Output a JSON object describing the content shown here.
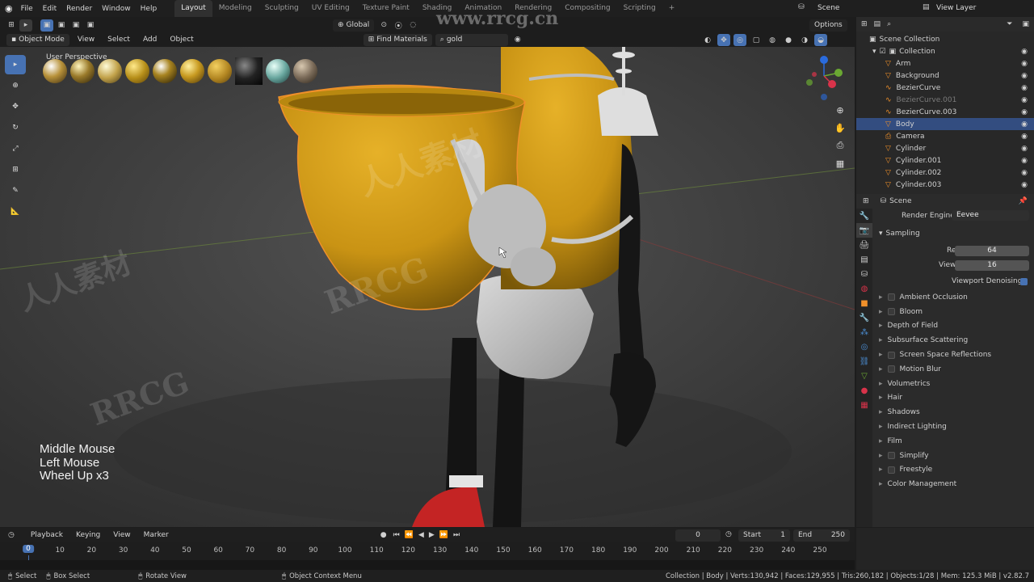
{
  "topbar": {
    "menus": [
      "File",
      "Edit",
      "Render",
      "Window",
      "Help"
    ],
    "tabs": [
      "Layout",
      "Modeling",
      "Sculpting",
      "UV Editing",
      "Texture Paint",
      "Shading",
      "Animation",
      "Rendering",
      "Compositing",
      "Scripting"
    ],
    "scene": "Scene",
    "view_layer": "View Layer"
  },
  "viewport_header": {
    "transform": "Global",
    "options": "Options",
    "mode": "Object Mode",
    "menus": [
      "View",
      "Select",
      "Add",
      "Object"
    ],
    "find_materials": "Find Materials",
    "search_value": "gold"
  },
  "viewport": {
    "perspective_label": "User Perspective",
    "overlay_lines": [
      "Middle Mouse",
      "Left Mouse",
      "Wheel Up x3"
    ],
    "watermark": "www.rrcg.cn",
    "watermark_brand": "RRCG",
    "watermark_cn": "人人素材"
  },
  "outliner": {
    "root": "Scene Collection",
    "collection": "Collection",
    "items": [
      {
        "name": "Arm",
        "selected": false,
        "dim": false
      },
      {
        "name": "Background",
        "selected": false,
        "dim": false
      },
      {
        "name": "BezierCurve",
        "selected": false,
        "dim": false
      },
      {
        "name": "BezierCurve.001",
        "selected": false,
        "dim": true
      },
      {
        "name": "BezierCurve.003",
        "selected": false,
        "dim": false
      },
      {
        "name": "Body",
        "selected": true,
        "dim": false
      },
      {
        "name": "Camera",
        "selected": false,
        "dim": false
      },
      {
        "name": "Cylinder",
        "selected": false,
        "dim": false
      },
      {
        "name": "Cylinder.001",
        "selected": false,
        "dim": false
      },
      {
        "name": "Cylinder.002",
        "selected": false,
        "dim": false
      },
      {
        "name": "Cylinder.003",
        "selected": false,
        "dim": false
      }
    ]
  },
  "properties": {
    "context": "Scene",
    "render_engine_label": "Render Engine",
    "render_engine": "Eevee",
    "sampling": "Sampling",
    "render_label": "Render",
    "render_value": "64",
    "viewport_label": "Viewport",
    "viewport_value": "16",
    "viewport_denoising": "Viewport Denoising",
    "panels": [
      {
        "label": "Ambient Occlusion",
        "checkbox": true
      },
      {
        "label": "Bloom",
        "checkbox": true
      },
      {
        "label": "Depth of Field",
        "checkbox": false
      },
      {
        "label": "Subsurface Scattering",
        "checkbox": false
      },
      {
        "label": "Screen Space Reflections",
        "checkbox": true
      },
      {
        "label": "Motion Blur",
        "checkbox": true
      },
      {
        "label": "Volumetrics",
        "checkbox": false
      },
      {
        "label": "Hair",
        "checkbox": false
      },
      {
        "label": "Shadows",
        "checkbox": false
      },
      {
        "label": "Indirect Lighting",
        "checkbox": false
      },
      {
        "label": "Film",
        "checkbox": false
      },
      {
        "label": "Simplify",
        "checkbox": true
      },
      {
        "label": "Freestyle",
        "checkbox": true
      },
      {
        "label": "Color Management",
        "checkbox": false
      }
    ]
  },
  "timeline": {
    "menus": [
      "Playback",
      "Keying",
      "View",
      "Marker"
    ],
    "current_frame": "0",
    "start_label": "Start",
    "start": "1",
    "end_label": "End",
    "end": "250",
    "ruler": [
      "0",
      "10",
      "20",
      "30",
      "40",
      "50",
      "60",
      "70",
      "80",
      "90",
      "100",
      "110",
      "120",
      "130",
      "140",
      "150",
      "160",
      "170",
      "180",
      "190",
      "200",
      "210",
      "220",
      "230",
      "240",
      "250"
    ]
  },
  "statusbar": {
    "left": [
      "Select",
      "Box Select",
      "Rotate View",
      "Object Context Menu"
    ],
    "right": "Collection | Body | Verts:130,942 | Faces:129,955 | Tris:260,182 | Objects:1/28 | Mem: 125.3 MiB | v2.82.7"
  },
  "colors": {
    "accent": "#4772b3",
    "selection": "#334d80",
    "gold": "#d8a21a",
    "outline": "#f0902a"
  }
}
